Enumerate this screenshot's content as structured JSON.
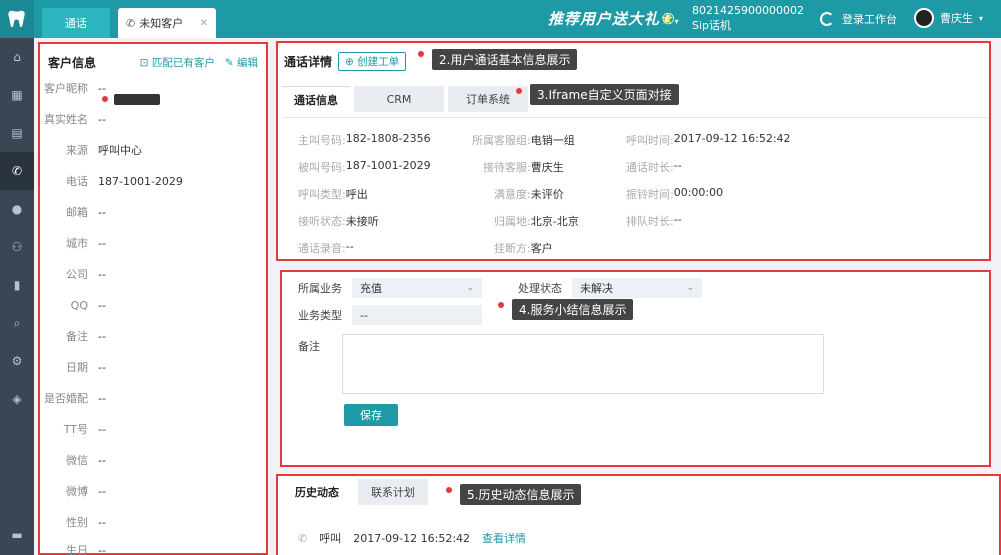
{
  "topbar": {
    "tab_call": "通话",
    "tab_customer": "未知客户",
    "promo": "推荐用户送大礼",
    "sip_number": "8021425900000002",
    "sip_label": "Sip话机",
    "login_label": "登录工作台",
    "user_name": "曹庆生"
  },
  "customer_panel": {
    "title": "客户信息",
    "match_label": "匹配已有客户",
    "edit_label": "编辑",
    "fields": [
      {
        "label": "客户昵称",
        "value": "--"
      },
      {
        "label": "真实姓名",
        "value": "--"
      },
      {
        "label": "来源",
        "value": "呼叫中心"
      },
      {
        "label": "电话",
        "value": "187-1001-2029"
      },
      {
        "label": "邮箱",
        "value": "--"
      },
      {
        "label": "城市",
        "value": "--"
      },
      {
        "label": "公司",
        "value": "--"
      },
      {
        "label": "QQ",
        "value": "--"
      },
      {
        "label": "备注",
        "value": "--"
      },
      {
        "label": "日期",
        "value": "--"
      },
      {
        "label": "是否婚配",
        "value": "--"
      },
      {
        "label": "TT号",
        "value": "--"
      },
      {
        "label": "微信",
        "value": "--"
      },
      {
        "label": "微博",
        "value": "--"
      },
      {
        "label": "性别",
        "value": "--"
      },
      {
        "label": "生日",
        "value": "--"
      }
    ]
  },
  "call_details": {
    "title": "通话详情",
    "create_order": "创建工单",
    "annotation_basic": "2.用户通话基本信息展示",
    "annotation_iframe": "3.Iframe自定义页面对接",
    "tabs": [
      "通话信息",
      "CRM",
      "订单系统"
    ],
    "info": [
      {
        "k": "主叫号码:",
        "v": "182-1808-2356"
      },
      {
        "k": "所属客服组:",
        "v": "电销一组"
      },
      {
        "k": "呼叫时间:",
        "v": "2017-09-12 16:52:42"
      },
      {
        "k": "被叫号码:",
        "v": "187-1001-2029"
      },
      {
        "k": "接待客服:",
        "v": "曹庆生"
      },
      {
        "k": "通话时长:",
        "v": "--"
      },
      {
        "k": "呼叫类型:",
        "v": "呼出"
      },
      {
        "k": "满意度:",
        "v": "未评价"
      },
      {
        "k": "振铃时间:",
        "v": "00:00:00"
      },
      {
        "k": "接听状态:",
        "v": "未接听"
      },
      {
        "k": "归属地:",
        "v": "北京-北京"
      },
      {
        "k": "排队时长:",
        "v": "--"
      },
      {
        "k": "通话录音:",
        "v": "--"
      },
      {
        "k": "挂断方:",
        "v": "客户"
      }
    ]
  },
  "service_summary": {
    "annotation": "4.服务小结信息展示",
    "business_label": "所属业务",
    "business_value": "充值",
    "status_label": "处理状态",
    "status_value": "未解决",
    "type_label": "业务类型",
    "type_value": "--",
    "note_label": "备注",
    "save_label": "保存"
  },
  "history": {
    "annotation": "5.历史动态信息展示",
    "tabs": [
      "历史动态",
      "联系计划"
    ],
    "entry_type": "呼叫",
    "entry_time": "2017-09-12 16:52:42",
    "entry_link": "查看详情"
  },
  "colors": {
    "accent": "#1d9aa5",
    "annotation_border": "#e23b3b",
    "sidebar": "#3a4653"
  }
}
